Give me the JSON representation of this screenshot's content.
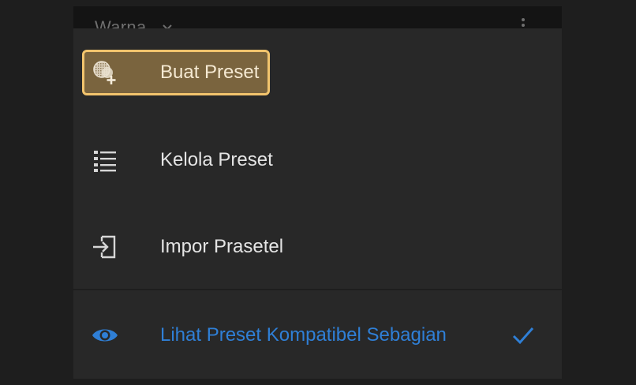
{
  "background_panel": {
    "title": "Warna"
  },
  "menu": {
    "items": [
      {
        "label": "Buat Preset",
        "icon": "preset-add-icon",
        "highlighted": true
      },
      {
        "label": "Kelola Preset",
        "icon": "list-icon"
      },
      {
        "label": "Impor Prasetel",
        "icon": "import-icon"
      },
      {
        "label": "Lihat Preset Kompatibel Sebagian",
        "icon": "eye-icon",
        "checked": true
      }
    ]
  },
  "colors": {
    "highlight_border": "#f2c46d",
    "accent_blue": "#2f7fd6",
    "menu_bg": "#282828"
  }
}
